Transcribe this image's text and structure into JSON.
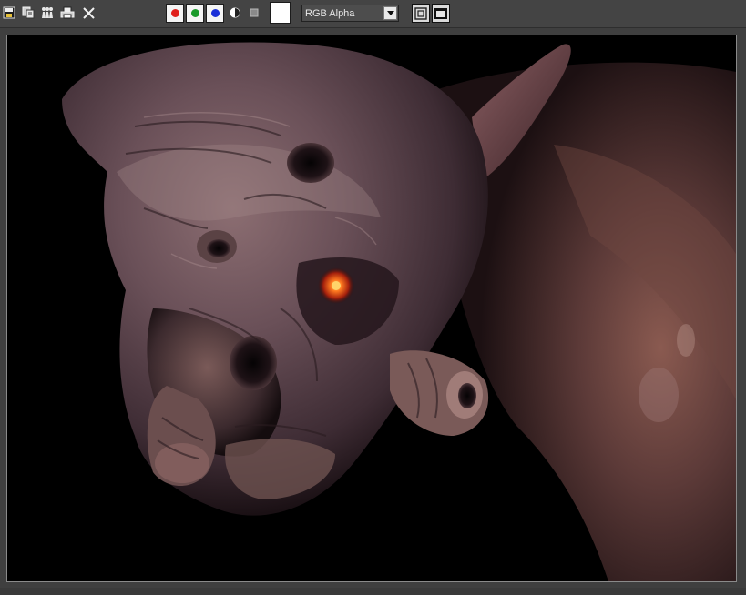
{
  "toolbar": {
    "icons": [
      "save-icon",
      "copy-icon",
      "clone-icon",
      "print-icon",
      "clear-icon"
    ],
    "channels": {
      "red": "#e0201c",
      "green": "#1a9a2a",
      "blue": "#1a2fd8"
    },
    "swatch_color": "#ffffff",
    "channel_display": {
      "selected": "RGB Alpha"
    }
  },
  "render": {
    "background": "#000000",
    "subject": "creature-render"
  }
}
